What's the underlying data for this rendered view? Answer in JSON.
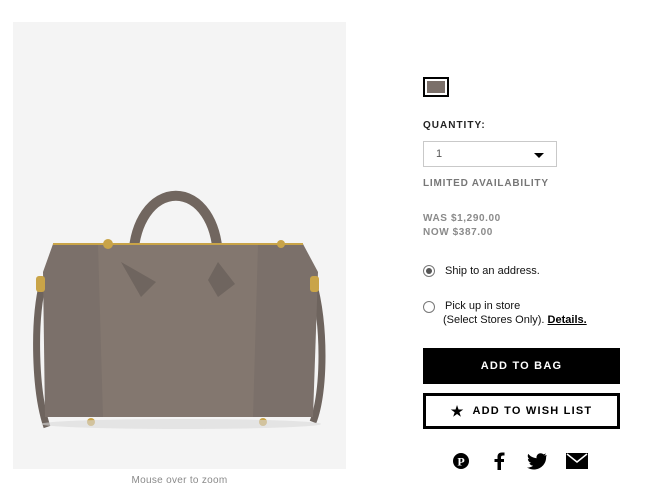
{
  "product": {
    "zoom_hint": "Mouse over to zoom",
    "swatch_color": "#7b706a",
    "image_icon": "handbag-image"
  },
  "quantity": {
    "label": "QUANTITY:",
    "selected": "1",
    "availability": "LIMITED AVAILABILITY"
  },
  "price": {
    "was": "WAS $1,290.00",
    "now": "NOW $387.00"
  },
  "delivery": {
    "ship_label": "Ship to an address.",
    "ship_selected": true,
    "pickup_label": "Pick up in store",
    "pickup_sub": "(Select Stores Only).",
    "details_link": "Details."
  },
  "actions": {
    "add_to_bag": "ADD TO BAG",
    "add_to_wishlist": "ADD TO WISH LIST",
    "wishlist_icon": "star-icon"
  },
  "share": {
    "icons": [
      "pinterest-icon",
      "facebook-icon",
      "twitter-icon",
      "email-icon"
    ]
  },
  "colors": {
    "bag": "#7b706a",
    "hardware": "#c9a448",
    "button": "#000000"
  }
}
